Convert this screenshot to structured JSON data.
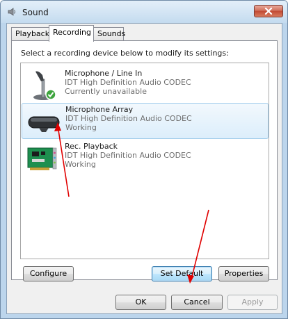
{
  "window": {
    "title": "Sound",
    "title_icon": "speaker-icon",
    "close_icon": "close-icon"
  },
  "tabs": [
    {
      "label": "Playback",
      "active": false
    },
    {
      "label": "Recording",
      "active": true
    },
    {
      "label": "Sounds",
      "active": false
    }
  ],
  "recording": {
    "instruction": "Select a recording device below to modify its settings:",
    "devices": [
      {
        "name": "Microphone / Line In",
        "driver": "IDT High Definition Audio CODEC",
        "status": "Currently unavailable",
        "icon": "microphone-stand-icon",
        "badge": "green-check-icon",
        "selected": false
      },
      {
        "name": "Microphone Array",
        "driver": "IDT High Definition Audio CODEC",
        "status": "Working",
        "icon": "microphone-array-icon",
        "selected": true
      },
      {
        "name": "Rec. Playback",
        "driver": "IDT High Definition Audio CODEC",
        "status": "Working",
        "icon": "sound-card-icon",
        "selected": false
      }
    ],
    "buttons": {
      "configure": "Configure",
      "set_default": "Set Default",
      "properties": "Properties"
    }
  },
  "footer": {
    "ok": "OK",
    "cancel": "Cancel",
    "apply": "Apply"
  },
  "colors": {
    "annotation_arrow": "#e00000",
    "selection": "#dceefb",
    "title_bar": "#c4dbef"
  }
}
